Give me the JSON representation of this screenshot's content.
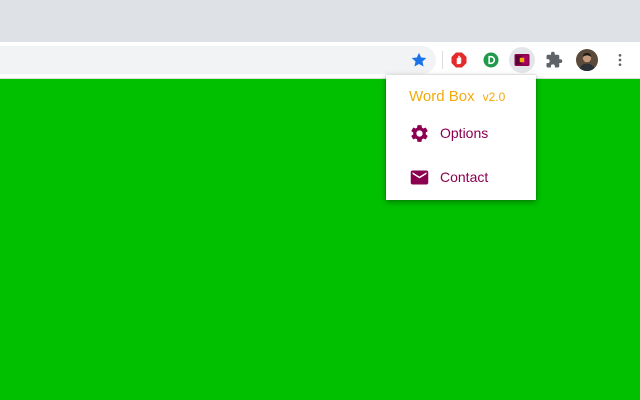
{
  "browser": {
    "toolbar": {
      "bookmark_icon": "star-icon",
      "extensions": [
        {
          "name": "adblock-icon",
          "color": "#e32b2b"
        },
        {
          "name": "d-extension-icon",
          "color": "#1e9a4a"
        },
        {
          "name": "word-box-icon",
          "color": "#8c0050"
        },
        {
          "name": "puzzle-icon",
          "color": "#5f6368"
        }
      ],
      "menu_icon": "kebab-menu-icon"
    }
  },
  "page": {
    "background_color": "#00c000"
  },
  "popup": {
    "title": "Word Box",
    "version": "v2.0",
    "accent_color": "#f2aa0a",
    "item_color": "#8c0050",
    "items": [
      {
        "label": "Options",
        "icon": "gear-icon"
      },
      {
        "label": "Contact",
        "icon": "mail-icon"
      }
    ]
  }
}
